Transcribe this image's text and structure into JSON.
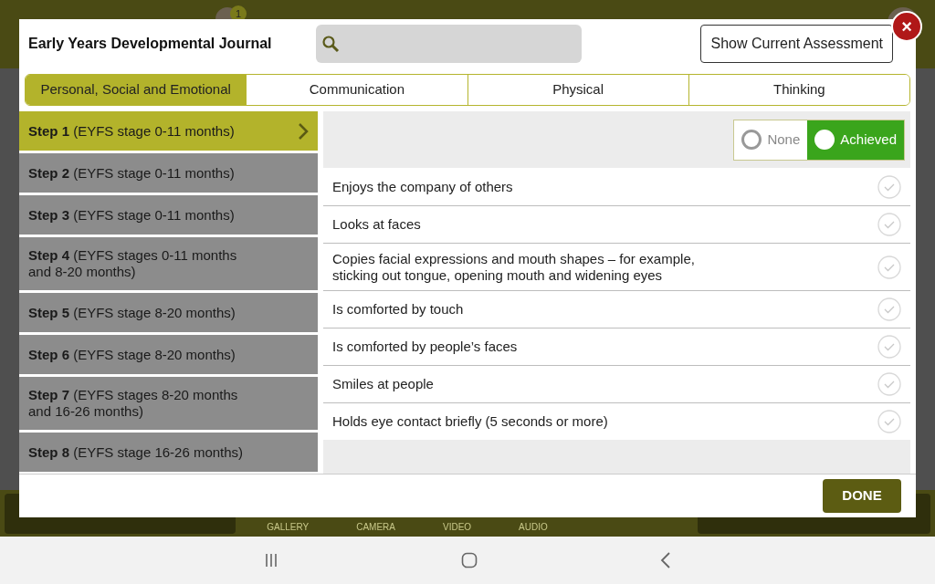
{
  "background": {
    "badge": "1",
    "media": [
      "GALLERY",
      "CAMERA",
      "VIDEO",
      "AUDIO"
    ]
  },
  "dialog": {
    "title": "Early Years Developmental Journal",
    "show_button": "Show Current Assessment",
    "close": "×",
    "tabs": [
      {
        "label": "Personal, Social and Emotional",
        "selected": true
      },
      {
        "label": "Communication",
        "selected": false
      },
      {
        "label": "Physical",
        "selected": false
      },
      {
        "label": "Thinking",
        "selected": false
      }
    ],
    "steps": [
      {
        "label": "**Step 1** (EYFS stage 0-11 months)",
        "selected": true
      },
      {
        "label": "**Step 2** (EYFS stage 0-11 months)",
        "selected": false
      },
      {
        "label": "**Step 3** (EYFS stage 0-11 months)",
        "selected": false
      },
      {
        "label": "**Step 4** (EYFS stages 0-11 months and 8-20 months)",
        "selected": false
      },
      {
        "label": "**Step 5** (EYFS stage 8-20 months)",
        "selected": false
      },
      {
        "label": "**Step 6** (EYFS stage 8-20 months)",
        "selected": false
      },
      {
        "label": "**Step 7** (EYFS stages 8-20 months and 16-26 months)",
        "selected": false
      },
      {
        "label": "**Step 8** (EYFS stage 16-26 months)",
        "selected": false
      }
    ],
    "filter": [
      {
        "label": "None",
        "selected": false
      },
      {
        "label": "Achieved",
        "selected": true
      }
    ],
    "items": [
      {
        "text": "Enjoys the company of others",
        "checked": false
      },
      {
        "text": "Looks at faces",
        "checked": false
      },
      {
        "text": "Copies facial expressions and mouth shapes – for example, sticking out tongue, opening mouth and widening eyes",
        "checked": false
      },
      {
        "text": "Is comforted by touch",
        "checked": false
      },
      {
        "text": "Is comforted by people’s faces",
        "checked": false
      },
      {
        "text": "Smiles at people",
        "checked": false
      },
      {
        "text": "Holds eye contact briefly (5 seconds or more)",
        "checked": false
      }
    ],
    "done": "DONE"
  }
}
